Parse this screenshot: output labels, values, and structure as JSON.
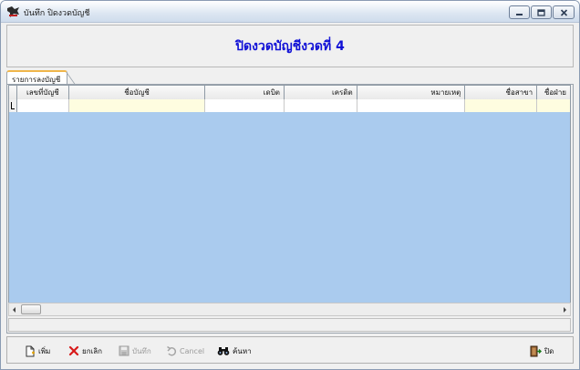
{
  "window": {
    "title": "บันทึก ปิดงวดบัญชี",
    "icon": "app-icon"
  },
  "header": {
    "title": "ปิดงวดบัญชีงวดที่ 4",
    "title_color": "#1010d6"
  },
  "tabs": [
    {
      "label": "รายการลงบัญชี",
      "active": true
    }
  ],
  "grid": {
    "background": "#aacbee",
    "columns": [
      {
        "label": ""
      },
      {
        "label": "เลขที่บัญชี"
      },
      {
        "label": "ชื่อบัญชี"
      },
      {
        "label": "เดบิต"
      },
      {
        "label": "เครดิต"
      },
      {
        "label": "หมายเหตุ"
      },
      {
        "label": "ชื่อสาขา"
      },
      {
        "label": "ชื่อฝ่าย"
      }
    ]
  },
  "toolbar": {
    "add_label": "เพิ่ม",
    "cancel_edit_label": "ยกเลิก",
    "save_label": "บันทึก",
    "cancel_label": "Cancel",
    "search_label": "ค้นหา",
    "close_label": "ปิด"
  }
}
